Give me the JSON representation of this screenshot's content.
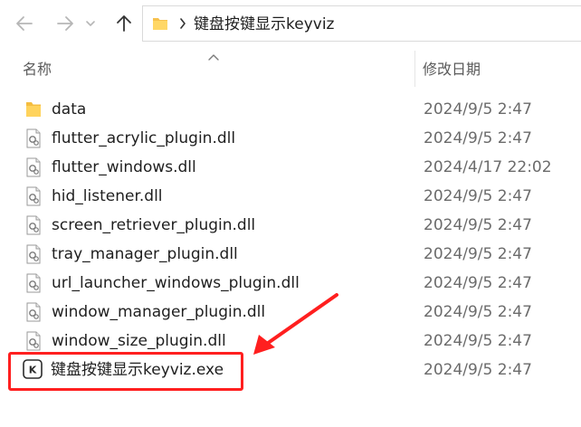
{
  "toolbar": {
    "back_icon": "arrow-left-icon",
    "forward_icon": "arrow-right-icon",
    "recent_icon": "chevron-down-icon",
    "up_icon": "arrow-up-icon"
  },
  "address": {
    "folder_icon": "folder-icon",
    "separator_icon": "chevron-right-icon",
    "path": "键盘按键显示keyviz"
  },
  "columns": {
    "name": "名称",
    "modified": "修改日期",
    "sort_icon": "sort-ascending-icon"
  },
  "files": [
    {
      "name": "data",
      "modified": "2024/9/5 2:47",
      "icon": "folder-icon"
    },
    {
      "name": "flutter_acrylic_plugin.dll",
      "modified": "2024/9/5 2:47",
      "icon": "dll-file-icon"
    },
    {
      "name": "flutter_windows.dll",
      "modified": "2024/4/17 22:02",
      "icon": "dll-file-icon"
    },
    {
      "name": "hid_listener.dll",
      "modified": "2024/9/5 2:47",
      "icon": "dll-file-icon"
    },
    {
      "name": "screen_retriever_plugin.dll",
      "modified": "2024/9/5 2:47",
      "icon": "dll-file-icon"
    },
    {
      "name": "tray_manager_plugin.dll",
      "modified": "2024/9/5 2:47",
      "icon": "dll-file-icon"
    },
    {
      "name": "url_launcher_windows_plugin.dll",
      "modified": "2024/9/5 2:47",
      "icon": "dll-file-icon"
    },
    {
      "name": "window_manager_plugin.dll",
      "modified": "2024/9/5 2:47",
      "icon": "dll-file-icon"
    },
    {
      "name": "window_size_plugin.dll",
      "modified": "2024/9/5 2:47",
      "icon": "dll-file-icon"
    },
    {
      "name": "键盘按键显示keyviz.exe",
      "modified": "2024/9/5 2:47",
      "icon": "keyviz-app-icon",
      "app_icon_letter": "K"
    }
  ],
  "annotation": {
    "color": "#ff1f1f",
    "highlight": "red-highlight-box",
    "pointer": "red-arrow"
  }
}
